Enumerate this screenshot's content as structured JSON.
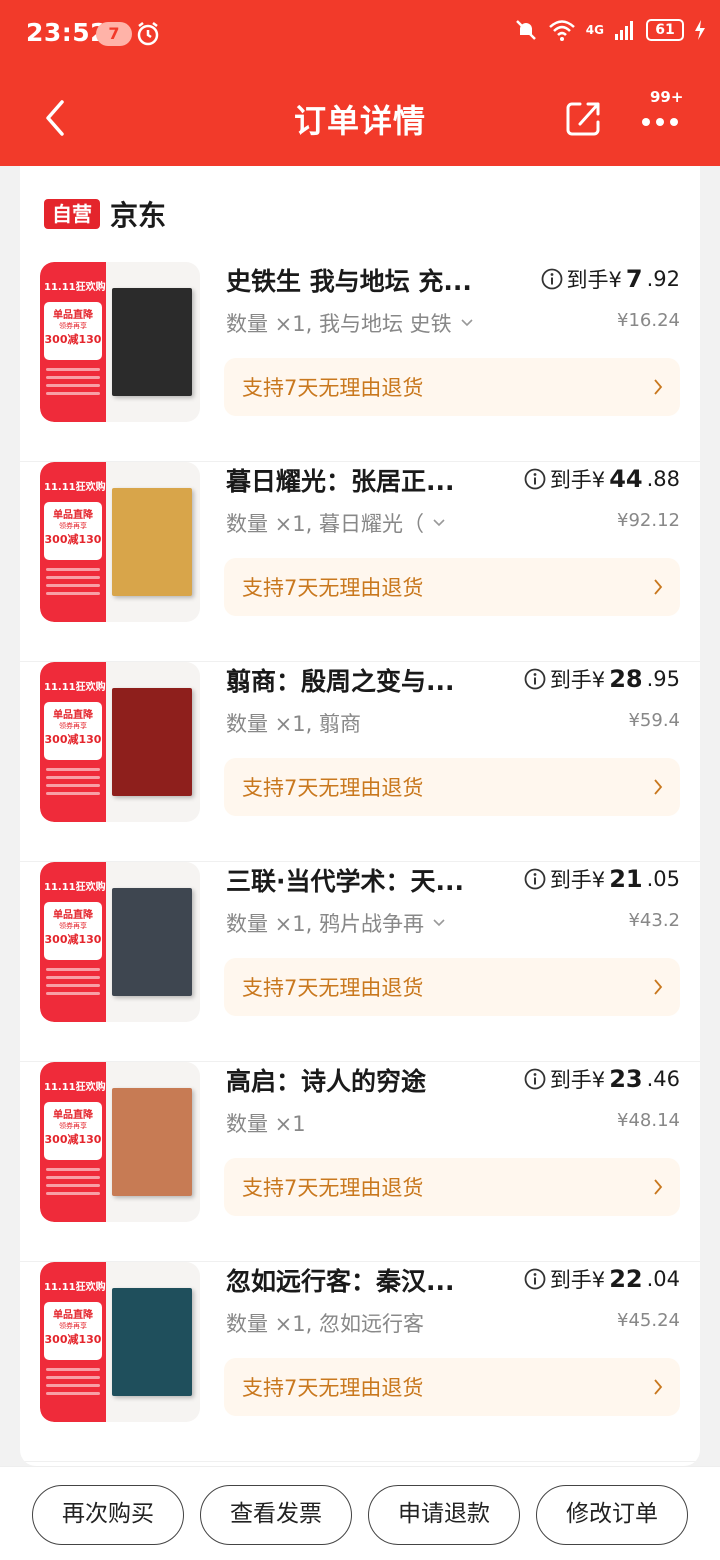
{
  "status_bar": {
    "time": "23:52",
    "notification_count": "7",
    "network": "4G",
    "battery": "61",
    "icons": [
      "alarm-icon",
      "mute-icon",
      "wifi-icon",
      "signal-icon",
      "charging-icon"
    ]
  },
  "navbar": {
    "title": "订单详情",
    "more_badge": "99+",
    "icons": [
      "back-icon",
      "share-icon",
      "more-icon"
    ]
  },
  "store": {
    "tag": "自营",
    "name": "京东"
  },
  "items": [
    {
      "title": "史铁生 我与地坛 充...",
      "price_label": "到手¥",
      "price_int": "7",
      "price_dec": ".92",
      "qty": "数量 ×1, 我与地坛 史铁",
      "has_dropdown": true,
      "original_price": "¥16.24",
      "return_policy": "支持7天无理由退货",
      "cover_color": "#2b2b2b"
    },
    {
      "title": "暮日耀光：张居正...",
      "price_label": "到手¥",
      "price_int": "44",
      "price_dec": ".88",
      "qty": "数量 ×1, 暮日耀光（",
      "has_dropdown": true,
      "original_price": "¥92.12",
      "return_policy": "支持7天无理由退货",
      "cover_color": "#d8a54a"
    },
    {
      "title": "翦商：殷周之变与...",
      "price_label": "到手¥",
      "price_int": "28",
      "price_dec": ".95",
      "qty": "数量 ×1, 翦商",
      "has_dropdown": false,
      "original_price": "¥59.4",
      "return_policy": "支持7天无理由退货",
      "cover_color": "#8e1f1c"
    },
    {
      "title": "三联·当代学术：天...",
      "price_label": "到手¥",
      "price_int": "21",
      "price_dec": ".05",
      "qty": "数量 ×1, 鸦片战争再",
      "has_dropdown": true,
      "original_price": "¥43.2",
      "return_policy": "支持7天无理由退货",
      "cover_color": "#3e4650"
    },
    {
      "title": "高启：诗人的穷途",
      "price_label": "到手¥",
      "price_int": "23",
      "price_dec": ".46",
      "qty": "数量 ×1",
      "has_dropdown": false,
      "original_price": "¥48.14",
      "return_policy": "支持7天无理由退货",
      "cover_color": "#c77b54"
    },
    {
      "title": "忽如远行客：秦汉...",
      "price_label": "到手¥",
      "price_int": "22",
      "price_dec": ".04",
      "qty": "数量 ×1, 忽如远行客",
      "has_dropdown": false,
      "original_price": "¥45.24",
      "return_policy": "支持7天无理由退货",
      "cover_color": "#1f4f5c"
    }
  ],
  "promo": {
    "top": "11.11狂欢购",
    "line1": "单品直降",
    "line2": "领券再享",
    "line3": "300减130"
  },
  "actions": {
    "buy_again": "再次购买",
    "view_invoice": "查看发票",
    "request_refund": "申请退款",
    "modify_order": "修改订单"
  },
  "colors": {
    "brand_red": "#f23a2a",
    "return_text": "#c9781e",
    "return_bg": "#fff7ee"
  }
}
